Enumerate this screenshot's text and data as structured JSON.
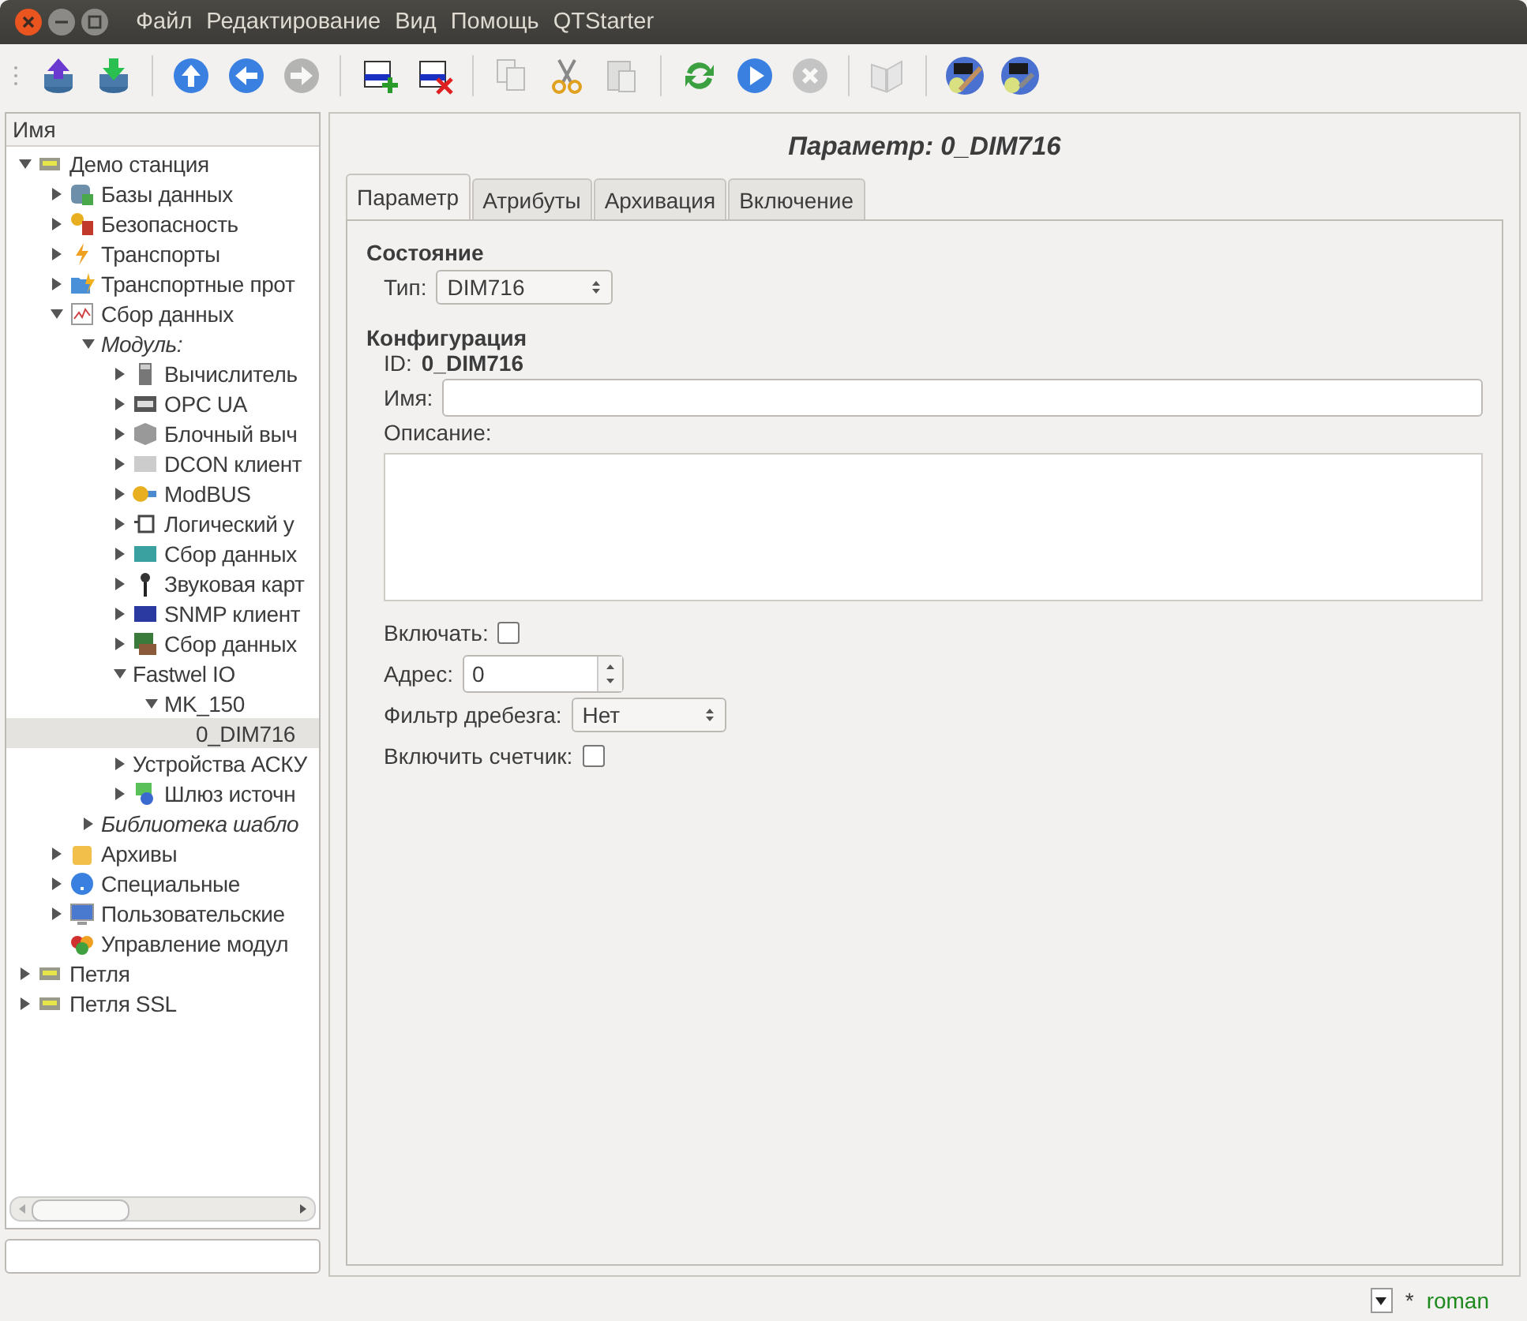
{
  "menu": [
    "Файл",
    "Редактирование",
    "Вид",
    "Помощь",
    "QTStarter"
  ],
  "toolbar": [
    {
      "kind": "button",
      "disabled": false
    },
    {
      "kind": "button",
      "disabled": false
    },
    {
      "kind": "separator"
    },
    {
      "kind": "button",
      "disabled": false
    },
    {
      "kind": "button",
      "disabled": false
    },
    {
      "kind": "button",
      "disabled": true
    },
    {
      "kind": "separator"
    },
    {
      "kind": "button",
      "disabled": false
    },
    {
      "kind": "button",
      "disabled": false
    },
    {
      "kind": "separator"
    },
    {
      "kind": "button",
      "disabled": true
    },
    {
      "kind": "button",
      "disabled": false
    },
    {
      "kind": "button",
      "disabled": true
    },
    {
      "kind": "separator"
    },
    {
      "kind": "button",
      "disabled": false
    },
    {
      "kind": "button",
      "disabled": false
    },
    {
      "kind": "button",
      "disabled": true
    },
    {
      "kind": "separator"
    },
    {
      "kind": "button",
      "disabled": true
    },
    {
      "kind": "separator"
    },
    {
      "kind": "button",
      "disabled": false
    },
    {
      "kind": "button",
      "disabled": false
    }
  ],
  "tree": {
    "header": "Имя",
    "items": [
      {
        "label": "Демо станция",
        "italic": false,
        "selected": false,
        "expanded": true,
        "children": [
          {
            "label": "Базы данных",
            "italic": false,
            "selected": false,
            "expanded": false
          },
          {
            "label": "Безопасность",
            "italic": false,
            "selected": false,
            "expanded": false
          },
          {
            "label": "Транспорты",
            "italic": false,
            "selected": false,
            "expanded": false
          },
          {
            "label": "Транспортные прот",
            "italic": false,
            "selected": false,
            "expanded": false
          },
          {
            "label": "Сбор данных",
            "italic": false,
            "selected": false,
            "expanded": true,
            "children": [
              {
                "label": "Модуль:",
                "italic": true,
                "selected": false,
                "expanded": true,
                "children": [
                  {
                    "label": "Вычислитель",
                    "italic": false,
                    "selected": false,
                    "expanded": false
                  },
                  {
                    "label": "OPC UA",
                    "italic": false,
                    "selected": false,
                    "expanded": false
                  },
                  {
                    "label": "Блочный выч",
                    "italic": false,
                    "selected": false,
                    "expanded": false
                  },
                  {
                    "label": "DCON клиент",
                    "italic": false,
                    "selected": false,
                    "expanded": false
                  },
                  {
                    "label": "ModBUS",
                    "italic": false,
                    "selected": false,
                    "expanded": false
                  },
                  {
                    "label": "Логический у",
                    "italic": false,
                    "selected": false,
                    "expanded": false
                  },
                  {
                    "label": "Сбор данных",
                    "italic": false,
                    "selected": false,
                    "expanded": false
                  },
                  {
                    "label": "Звуковая карт",
                    "italic": false,
                    "selected": false,
                    "expanded": false
                  },
                  {
                    "label": "SNMP клиент",
                    "italic": false,
                    "selected": false,
                    "expanded": false
                  },
                  {
                    "label": "Сбор данных",
                    "italic": false,
                    "selected": false,
                    "expanded": false
                  },
                  {
                    "label": "Fastwel IO",
                    "italic": false,
                    "selected": false,
                    "expanded": true,
                    "children": [
                      {
                        "label": "MK_150",
                        "italic": false,
                        "selected": false,
                        "expanded": true,
                        "children": [
                          {
                            "label": "0_DIM716",
                            "italic": false,
                            "selected": true
                          }
                        ]
                      }
                    ]
                  },
                  {
                    "label": "Устройства АСКУ",
                    "italic": false,
                    "selected": false,
                    "expanded": false
                  },
                  {
                    "label": "Шлюз источн",
                    "italic": false,
                    "selected": false,
                    "expanded": false
                  }
                ]
              },
              {
                "label": "Библиотека шабло",
                "italic": true,
                "selected": false,
                "expanded": false
              }
            ]
          },
          {
            "label": "Архивы",
            "italic": false,
            "selected": false,
            "expanded": false
          },
          {
            "label": "Специальные",
            "italic": false,
            "selected": false,
            "expanded": false
          },
          {
            "label": "Пользовательские",
            "italic": false,
            "selected": false,
            "expanded": false
          },
          {
            "label": "Управление модул",
            "italic": false,
            "selected": false
          }
        ]
      },
      {
        "label": "Петля",
        "italic": false,
        "selected": false,
        "expanded": false
      },
      {
        "label": "Петля SSL",
        "italic": false,
        "selected": false,
        "expanded": false
      }
    ]
  },
  "panel_title": "Параметр: 0_DIM716",
  "tabs": [
    {
      "label": "Параметр",
      "selected": true
    },
    {
      "label": "Атрибуты",
      "selected": false
    },
    {
      "label": "Архивация",
      "selected": false
    },
    {
      "label": "Включение",
      "selected": false
    }
  ],
  "form": {
    "state_heading": "Состояние",
    "type_label": "Тип:",
    "type_value": "DIM716",
    "config_heading": "Конфигурация",
    "id_label": "ID:",
    "id_value": "0_DIM716",
    "name_label": "Имя:",
    "description_label": "Описание:",
    "enable_label": "Включать:",
    "enable_checked": false,
    "address_label": "Адрес:",
    "address_value": "0",
    "filter_label": "Фильтр дребезга:",
    "filter_value": "Нет",
    "counter_label": "Включить счетчик:",
    "counter_checked": false
  },
  "status_bar": {
    "modified": "*",
    "user": "roman"
  }
}
